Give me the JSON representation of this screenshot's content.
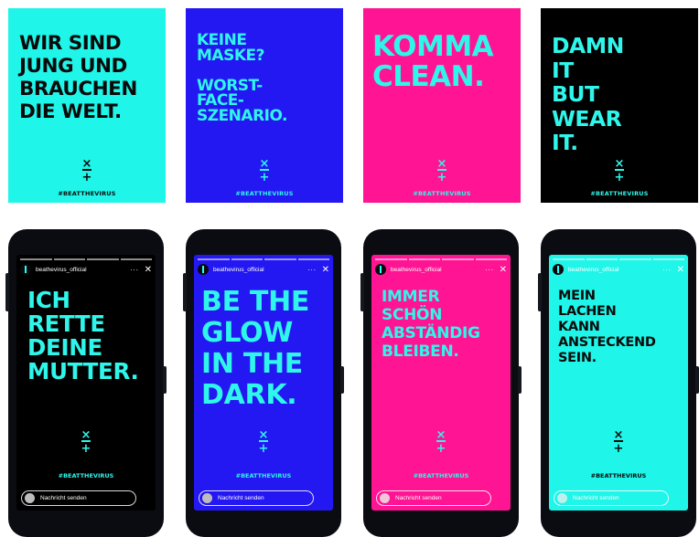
{
  "posters": [
    {
      "headline": "WIR SIND\nJUNG UND\nBRAUCHEN\nDIE WELT.",
      "hashtag": "#BEATTHEVIRUS",
      "bg": "#1ff5e8",
      "fg": "#0a0a0a"
    },
    {
      "headline": "KEINE\nMASKE?\n\nWORST-\nFACE-\nSZENARIO.",
      "hashtag": "#BEATTHEVIRUS",
      "bg": "#2418f2",
      "fg": "#2ff6ea"
    },
    {
      "headline": "KOMMA\nCLEAN.",
      "hashtag": "#BEATTHEVIRUS",
      "bg": "#ff1493",
      "fg": "#2ff6ea"
    },
    {
      "headline": "DAMN\nIT\nBUT\nWEAR\nIT.",
      "hashtag": "#BEATTHEVIRUS",
      "bg": "#000000",
      "fg": "#2ff6ea"
    }
  ],
  "stories": [
    {
      "username": "beathevirus_official",
      "headline": "ICH\nRETTE\nDEINE\nMUTTER.",
      "hashtag": "#BEATTHEVIRUS",
      "reply_placeholder": "Nachricht senden",
      "bg": "#000000",
      "fg": "#2ff6ea"
    },
    {
      "username": "beathevirus_official",
      "headline": "BE THE\nGLOW\nIN THE\nDARK.",
      "hashtag": "#BEATTHEVIRUS",
      "reply_placeholder": "Nachricht senden",
      "bg": "#2418f2",
      "fg": "#2ff6ea"
    },
    {
      "username": "beathevirus_official",
      "headline": "IMMER\nSCHÖN\nABSTÄNDIG\nBLEIBEN.",
      "hashtag": "#BEATTHEVIRUS",
      "reply_placeholder": "Nachricht senden",
      "bg": "#ff1493",
      "fg": "#2ff6ea"
    },
    {
      "username": "beathevirus_official",
      "headline": "MEIN\nLACHEN\nKANN\nANSTECKEND\nSEIN.",
      "hashtag": "#BEATTHEVIRUS",
      "reply_placeholder": "Nachricht senden",
      "bg": "#1ff5e8",
      "fg": "#0a0a0a"
    }
  ],
  "icons": {
    "more": "more-dots-icon",
    "close": "close-icon",
    "symbol": "times-minus-plus-icon"
  }
}
